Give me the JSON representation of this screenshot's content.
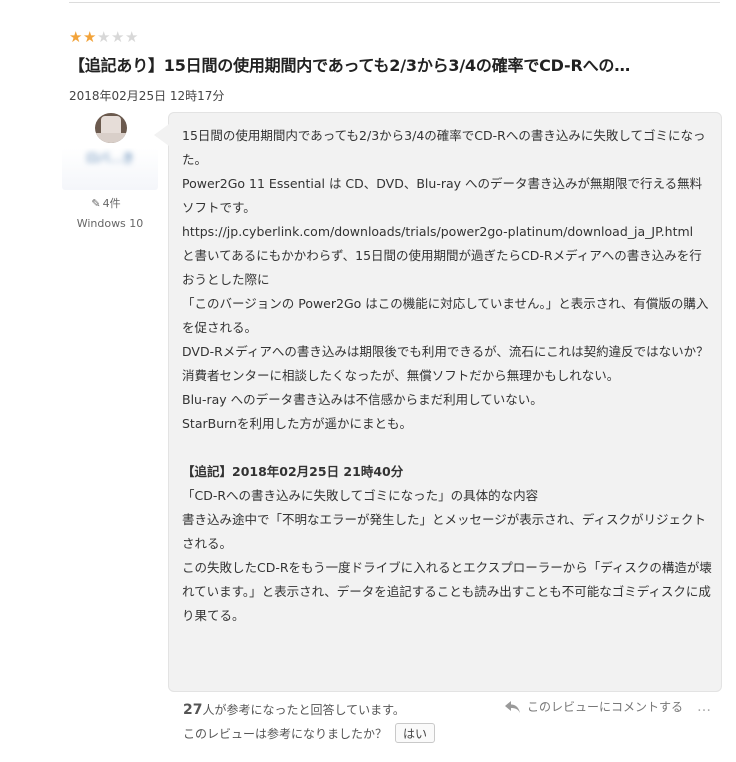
{
  "review": {
    "rating": 2,
    "rating_max": 5,
    "title": "【追記あり】15日間の使用期間内であっても2/3から3/4の確率でCD-Rへの…",
    "date": "2018年02月25日 12時17分",
    "author": {
      "name": "ロバ…き",
      "review_count": "4件",
      "os": "Windows 10"
    },
    "body": [
      "15日間の使用期間内であっても2/3から3/4の確率でCD-Rへの書き込みに失敗してゴミになった。",
      "Power2Go 11 Essential は CD、DVD、Blu-ray へのデータ書き込みが無期限で行える無料ソフトです。",
      "https://jp.cyberlink.com/downloads/trials/power2go-platinum/download_ja_JP.html",
      "と書いてあるにもかかわらず、15日間の使用期間が過ぎたらCD-Rメディアへの書き込みを行おうとした際に",
      "「このバージョンの Power2Go はこの機能に対応していません。」と表示され、有償版の購入を促される。",
      "DVD-Rメディアへの書き込みは期限後でも利用できるが、流石にこれは契約違反ではないか？",
      "消費者センターに相談したくなったが、無償ソフトだから無理かもしれない。",
      "Blu-ray へのデータ書き込みは不信感からまだ利用していない。",
      "StarBurnを利用した方が遥かにまとも。"
    ],
    "addendum_heading": "【追記】2018年02月25日 21時40分",
    "addendum": [
      "「CD-Rへの書き込みに失敗してゴミになった」の具体的な内容",
      "書き込み途中で「不明なエラーが発生した」とメッセージが表示され、ディスクがリジェクトされる。",
      "この失敗したCD-Rをもう一度ドライブに入れるとエクスプローラーから「ディスクの構造が壊れています。」と表示され、データを追記することも読み出すことも不可能なゴミディスクに成り果てる。"
    ]
  },
  "footer": {
    "helpful_count": "27",
    "helpful_text": "人が参考になったと回答しています。",
    "comment_link": "このレビューにコメントする",
    "more": "…",
    "question": "このレビューは参考になりましたか？",
    "yes_button": "はい"
  },
  "icons": {
    "star_filled": "star-icon",
    "star_empty": "star-icon",
    "pencil": "pencil-icon",
    "reply": "reply-icon",
    "more": "ellipsis-icon"
  },
  "colors": {
    "star_on": "#f2a33a",
    "star_off": "#d8d8d8",
    "bubble_bg": "#f2f2f2",
    "link": "#3a6ea5"
  }
}
